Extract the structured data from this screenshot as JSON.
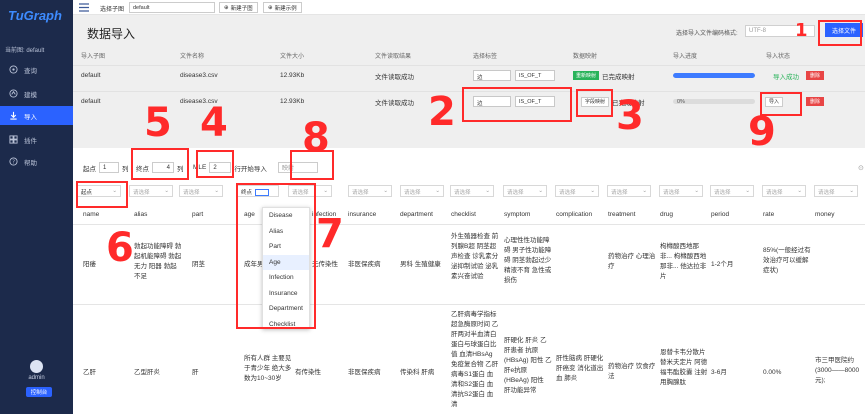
{
  "sidebar": {
    "logo": "TuGraph",
    "current_graph": "当前图: default",
    "items": [
      {
        "label": "查询",
        "icon": "query-icon",
        "active": false
      },
      {
        "label": "建模",
        "icon": "model-icon",
        "active": false
      },
      {
        "label": "导入",
        "icon": "import-icon",
        "active": true
      },
      {
        "label": "插件",
        "icon": "plugin-icon",
        "active": false
      },
      {
        "label": "帮助",
        "icon": "help-icon",
        "active": false
      }
    ],
    "username": "admin",
    "console_label": "控制台"
  },
  "topbar": {
    "select_label": "选择子图",
    "select_value": "default",
    "new_subgraph": "新建子图",
    "new_example": "新建示例"
  },
  "page": {
    "title": "数据导入",
    "encoding_label": "选择导入文件编码格式:",
    "encoding_value": "UTF-8",
    "select_file_btn": "选择文件"
  },
  "import_table": {
    "headers": [
      "导入子图",
      "文件名称",
      "文件大小",
      "文件读取结果",
      "选择标签",
      "数据映射",
      "导入进度",
      "导入状态"
    ],
    "rows": [
      {
        "subgraph": "default",
        "filename": "disease3.csv",
        "size": "12.93Kb",
        "read_result": "文件读取成功",
        "label_type": "边",
        "label_name": "IS_OF_T",
        "mapping_btn": "重新映射",
        "mapping_status": "已完成映射",
        "progress_text": "",
        "progress": 1.0,
        "status": "导入成功",
        "delete": "删除"
      },
      {
        "subgraph": "default",
        "filename": "disease3.csv",
        "size": "12.93Kb",
        "read_result": "文件读取成功",
        "label_type": "边",
        "label_name": "IS_OF_T",
        "mapping_btn": "字段映射",
        "mapping_status": "已完成映射",
        "progress_text": "0%",
        "progress": 0.0,
        "status": "导入",
        "delete": "删除"
      }
    ]
  },
  "mapping": {
    "start_label": "起点",
    "start_value": "1",
    "start_unit": "列",
    "end_label": "终点",
    "end_value": "4",
    "end_unit": "列",
    "multi_label": "MLE",
    "multi_value": "2",
    "row_import_label": "行开始导入",
    "confirm_btn": "映射",
    "column_selects": [
      "起点",
      "请选择",
      "请选择",
      "终点",
      "请选择",
      "请选择",
      "请选择",
      "请选择",
      "请选择",
      "请选择",
      "请选择",
      "请选择",
      "请选择",
      "请选择",
      "请选择",
      "请选择",
      "请选择"
    ],
    "columns": [
      "name",
      "alias",
      "part",
      "age",
      "infection",
      "insurance",
      "department",
      "checklist",
      "symptom",
      "complication",
      "treatment",
      "drug",
      "period",
      "rate",
      "money"
    ],
    "dropdown_options": [
      "Disease",
      "Alias",
      "Part",
      "Age",
      "Infection",
      "Insurance",
      "Department",
      "Checklist"
    ],
    "rows": [
      [
        "阳痿",
        "勃起功能障碍 勃起机能障碍 勃起无力 阳器 勃起不足",
        "阴茎",
        "成年男性",
        "无传染性",
        "非医保疾病",
        "男科 生殖健康",
        "外生殖器检查 前列腺B超 阴茎超声检查 诊乳素分泌抑制试验 泌乳素兴奋试验",
        "心理性性功能障碍 男子性功能障碍 阴茎勃起过少 精液不育 急性或损伤",
        "",
        "药物治疗 心理治疗",
        "枸橼酸西地那非... 枸橼酸西地那非... 他达拉非片",
        "1-2个月",
        "85%(一般经过有效治疗可以缓解症状)",
        ""
      ],
      [
        "乙肝",
        "乙型肝炎",
        "肝",
        "所有人群 主要见于青少年 绝大多数为10~30岁",
        "有传染性",
        "非医保疾病",
        "传染科 肝病",
        "乙肝病毒学指标 超急酶原时间 乙肝两对半血清白蛋白与球蛋白比值 血清HBsAg免疫复合物 乙肝病毒S1蛋白 血清和S2蛋白 血清抗S2蛋白 血清",
        "肝硬化 肝炎 乙肝患者 抗原(HBsAg) 阳性 乙肝e抗原(HBeAg) 阳性 肝功能异常",
        "肝性脑病 肝硬化 肝癌变 消化道出血 肺炎",
        "药物治疗 饮食疗法",
        "恩替卡韦分散片 替米夫定片 阿德福韦酯胶囊 注射用胸腺肽",
        "3-6月",
        "0.00%",
        "市三甲医院约(3000——8000元);"
      ]
    ]
  },
  "annotations": [
    "1",
    "2",
    "3",
    "4",
    "5",
    "6",
    "7",
    "8",
    "9"
  ]
}
